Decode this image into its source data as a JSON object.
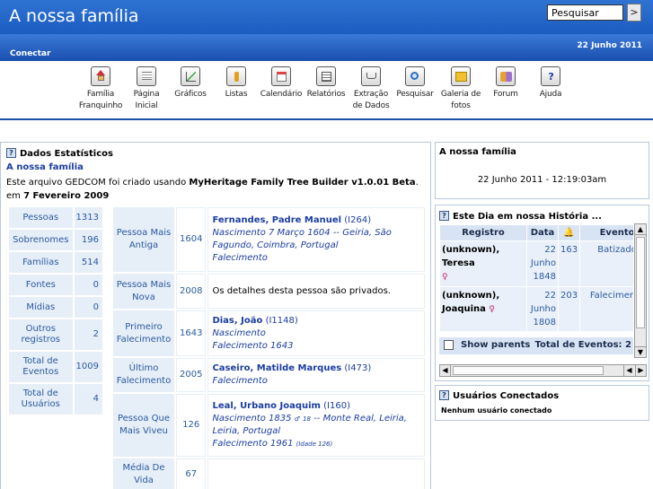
{
  "header": {
    "site_title": "A nossa família",
    "search_placeholder": "Pesquisar",
    "search_go": ">",
    "date": "22 Junho 2011",
    "connect": "Conectar"
  },
  "toolbar": {
    "items": [
      {
        "line1": "Família",
        "line2": "Franquinho",
        "icon": "home-icon"
      },
      {
        "line1": "Página",
        "line2": "Inicial",
        "icon": "page-icon"
      },
      {
        "line1": "Gráficos",
        "line2": "",
        "icon": "chart-icon"
      },
      {
        "line1": "Listas",
        "line2": "",
        "icon": "list-icon"
      },
      {
        "line1": "Calendário",
        "line2": "",
        "icon": "calendar-icon"
      },
      {
        "line1": "Relatórios",
        "line2": "",
        "icon": "report-icon"
      },
      {
        "line1": "Extração",
        "line2": "de Dados",
        "icon": "cart-icon"
      },
      {
        "line1": "Pesquisar",
        "line2": "",
        "icon": "magnifier-icon"
      },
      {
        "line1": "Galeria de",
        "line2": "fotos",
        "icon": "photo-icon"
      },
      {
        "line1": "Forum",
        "line2": "",
        "icon": "forum-icon"
      },
      {
        "line1": "Ajuda",
        "line2": "",
        "icon": "help-icon"
      }
    ]
  },
  "stats": {
    "title": "Dados Estatísticos",
    "family_link": "A nossa família",
    "intro_prefix": "Este arquivo GEDCOM foi criado usando ",
    "intro_software": "MyHeritage Family Tree Builder v1.0.01 Beta",
    "intro_mid": ". em ",
    "intro_date": "7 Fevereiro 2009",
    "counts": [
      {
        "label": "Pessoas",
        "value": "1313"
      },
      {
        "label": "Sobrenomes",
        "value": "196"
      },
      {
        "label": "Famílias",
        "value": "514"
      },
      {
        "label": "Fontes",
        "value": "0"
      },
      {
        "label": "Mídias",
        "value": "0"
      },
      {
        "label": "Outros registros",
        "value": "2"
      },
      {
        "label": "Total de Eventos",
        "value": "1009"
      },
      {
        "label": "Total de Usuários",
        "value": "4"
      }
    ],
    "details": {
      "oldest": {
        "label": "Pessoa Mais Antiga",
        "year": "1604",
        "name": "Fernandes, Padre Manuel",
        "id": "(I264)",
        "ev1": "Nascimento 7 Março 1604 -- Geiria, São Fagundo, Coimbra, Portugal",
        "ev2": "Falecimento"
      },
      "youngest": {
        "label": "Pessoa Mais Nova",
        "year": "2008",
        "text": "Os detalhes desta pessoa são privados."
      },
      "first_death": {
        "label": "Primeiro Falecimento",
        "year": "1643",
        "name": "Dias, João",
        "id": "(I1148)",
        "ev1": "Nascimento",
        "ev2": "Falecimento 1643"
      },
      "last_death": {
        "label": "Último Falecimento",
        "year": "2005",
        "name": "Caseiro, Matilde Marques",
        "id": "(I473)",
        "ev1": "Falecimento"
      },
      "longest": {
        "label": "Pessoa Que Mais Viveu",
        "year": "126",
        "name": "Leal, Urbano Joaquim",
        "id": "(I160)",
        "ev1a": "Nascimento 1835 ",
        "male_sym": "♂",
        "age": "18",
        "ev1b": " -- Monte Real, Leiria, Leiria, Portugal",
        "ev2": "Falecimento 1961 ",
        "ev2_small": "(Idade 126)"
      },
      "avg_life": {
        "label": "Média De Vida",
        "year": "67"
      }
    }
  },
  "family_box": {
    "title": "A nossa família",
    "datetime": "22 Junho 2011 - 12:19:03am"
  },
  "day_box": {
    "title": "Este Dia em nossa História ...",
    "headers": {
      "record": "Registro",
      "date": "Data",
      "event": "Evento"
    },
    "rows": [
      {
        "name": "(unknown), Teresa",
        "sex": "♀",
        "date": "22 Junho 1848",
        "age": "163",
        "event": "Batizado"
      },
      {
        "name": "(unknown), Joaquina",
        "sex": "♀",
        "date": "22 Junho 1808",
        "age": "203",
        "event": "Falecimento"
      }
    ],
    "show_parents": "Show parents",
    "total_events": "Total de Eventos: 2"
  },
  "users_box": {
    "title": "Usuários Conectados",
    "none": "Nenhum usuário conectado"
  }
}
